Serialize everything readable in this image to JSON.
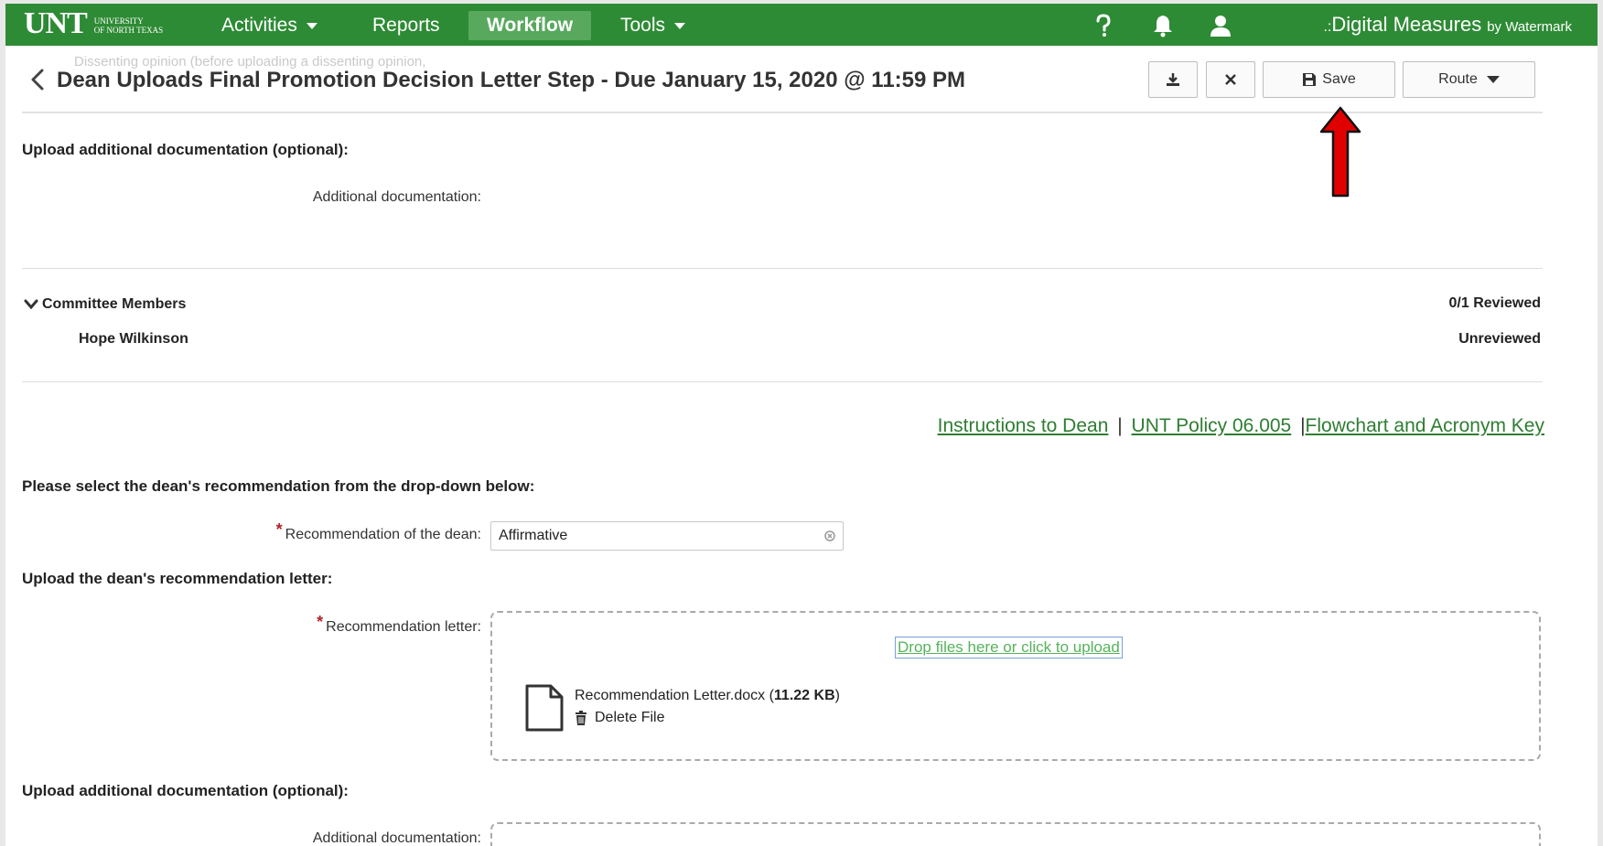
{
  "navbar": {
    "logo_main": "UNT",
    "logo_sub_line1": "UNIVERSITY",
    "logo_sub_line2": "OF NORTH TEXAS",
    "items": [
      {
        "label": "Activities",
        "has_caret": true
      },
      {
        "label": "Reports",
        "has_caret": false
      },
      {
        "label": "Workflow",
        "has_caret": false,
        "active": true
      },
      {
        "label": "Tools",
        "has_caret": true
      }
    ],
    "icons": [
      "help-icon",
      "bell-icon",
      "user-icon"
    ],
    "brand": "Digital Measures",
    "brand_sub": "by Watermark"
  },
  "ghost_text": "Dissenting opinion (before uploading a dissenting opinion,",
  "header": {
    "title": "Dean Uploads Final Promotion Decision Letter Step - Due January 15, 2020 @ 11:59 PM",
    "save_label": "Save",
    "route_label": "Route"
  },
  "section1": {
    "heading": "Upload additional documentation (optional):",
    "field_label": "Additional documentation:"
  },
  "committee": {
    "heading": "Committee Members",
    "reviewed_count": "0/1 Reviewed",
    "members": [
      {
        "name": "Hope Wilkinson",
        "status": "Unreviewed"
      }
    ]
  },
  "links": {
    "instructions": "Instructions to Dean",
    "policy": "UNT Policy 06.005",
    "flowchart": "Flowchart and Acronym Key",
    "sep1": "|",
    "sep2": "|"
  },
  "recommendation": {
    "heading": "Please select the dean's recommendation from the drop-down below:",
    "field_label": "Recommendation of the dean:",
    "value": "Affirmative"
  },
  "letter": {
    "heading": "Upload the dean's recommendation letter:",
    "field_label": "Recommendation letter:",
    "drop_text": "Drop files here or click to upload",
    "file_name": "Recommendation Letter.docx",
    "file_size": "11.22 KB",
    "delete_label": "Delete File"
  },
  "section2": {
    "heading": "Upload additional documentation (optional):",
    "field_label": "Additional documentation:"
  },
  "colors": {
    "navbar": "#2e8b35",
    "link": "#2e7d32",
    "required": "#b0242a",
    "annotation_arrow": "#e00000"
  }
}
